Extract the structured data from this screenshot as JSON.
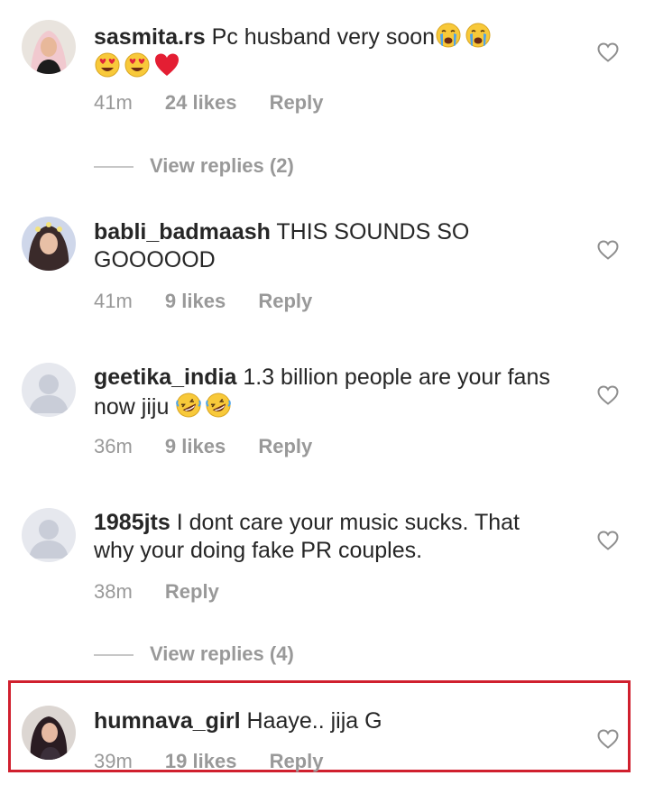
{
  "comments": [
    {
      "username": "sasmita.rs",
      "text": "Pc husband very soon",
      "emoji_line1": [
        "crying-face",
        "crying-face"
      ],
      "emoji_line2": [
        "heart-eyes-face",
        "heart-eyes-face",
        "red-heart"
      ],
      "time": "41m",
      "likes": "24 likes",
      "reply": "Reply",
      "view_replies": "View replies (2)"
    },
    {
      "username": "babli_badmaash",
      "text": "THIS SOUNDS SO GOOOOOD",
      "time": "41m",
      "likes": "9 likes",
      "reply": "Reply"
    },
    {
      "username": "geetika_india",
      "text": "1.3 billion people are your fans now jiju",
      "emoji": [
        "rolling-laughing-face",
        "rolling-laughing-face"
      ],
      "time": "36m",
      "likes": "9 likes",
      "reply": "Reply"
    },
    {
      "username": "1985jts",
      "text": "I dont care your music sucks. That why your doing fake PR couples.",
      "time": "38m",
      "reply": "Reply",
      "view_replies": "View replies (4)"
    },
    {
      "username": "humnava_girl",
      "text": "Haaye.. jija G",
      "time": "39m",
      "likes": "19 likes",
      "reply": "Reply",
      "highlighted": true
    }
  ],
  "colors": {
    "text": "#262626",
    "meta": "#999999",
    "highlight_border": "#d0202e",
    "heart_outline": "#8e8e8e",
    "default_avatar_bg": "#dbdbdb"
  },
  "icons": {
    "like": "heart-outline-icon",
    "default_avatar": "default-user-silhouette"
  }
}
